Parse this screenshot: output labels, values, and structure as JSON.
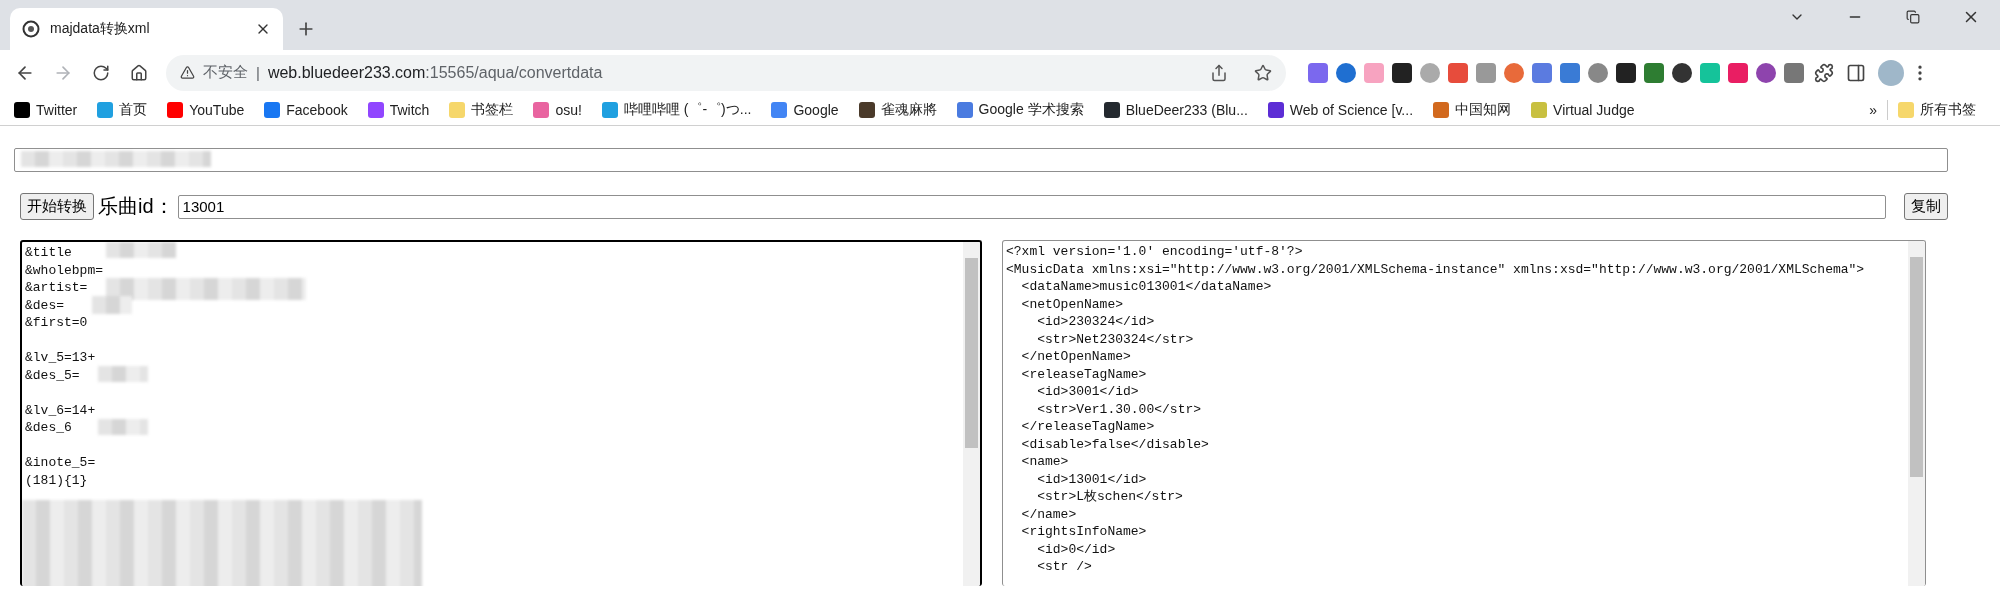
{
  "browser": {
    "tab": {
      "title": "majdata转换xml",
      "selected": true
    },
    "address": {
      "security": "不安全",
      "separator": "|",
      "host": "web.bluedeer233.com",
      "path": ":15565/aqua/convertdata"
    },
    "forward_disabled": true,
    "bookmarks": [
      {
        "label": "Twitter",
        "color": "#000000"
      },
      {
        "label": "首页",
        "color": "#20a0e0"
      },
      {
        "label": "YouTube",
        "color": "#ff0000"
      },
      {
        "label": "Facebook",
        "color": "#1877f2"
      },
      {
        "label": "Twitch",
        "color": "#9146ff"
      },
      {
        "label": "书签栏",
        "color": "#f6d76b"
      },
      {
        "label": "osu!",
        "color": "#e964a0"
      },
      {
        "label": "哔哩哔哩 (゜-゜)つ...",
        "color": "#20a0e0"
      },
      {
        "label": "Google",
        "color": "#4285f4"
      },
      {
        "label": "雀魂麻將",
        "color": "#4a3a2a"
      },
      {
        "label": "Google 学术搜索",
        "color": "#4a7be0"
      },
      {
        "label": "BlueDeer233 (Blu...",
        "color": "#24292f"
      },
      {
        "label": "Web of Science [v...",
        "color": "#5c2dd5"
      },
      {
        "label": "中国知网",
        "color": "#d2691e"
      },
      {
        "label": "Virtual Judge",
        "color": "#c8c040"
      }
    ],
    "overflow": "»",
    "all_bookmarks": {
      "label": "所有书签",
      "color": "#f6d76b"
    }
  },
  "page": {
    "start_button": "开始转换",
    "id_label": "乐曲id：",
    "id_value": "13001",
    "copy_button": "复制",
    "source": {
      "focused": true,
      "blocks": [
        [
          "&title",
          "&wholebpm=",
          "&artist=",
          "&des=",
          "&first=0"
        ],
        [
          "&lv_5=13+",
          "&des_5="
        ],
        [
          "&lv_6=14+",
          "&des_6"
        ],
        [
          "&inote_5=",
          "(181){1}"
        ]
      ]
    },
    "output": {
      "focused": false,
      "blocks": [
        [
          "<?xml version='1.0' encoding='utf-8'?>",
          "<MusicData xmlns:xsi=\"http://www.w3.org/2001/XMLSchema-instance\" xmlns:xsd=\"http://www.w3.org/2001/XMLSchema\">",
          "  <dataName>music013001</dataName>",
          "  <netOpenName>",
          "    <id>230324</id>",
          "    <str>Net230324</str>",
          "  </netOpenName>",
          "  <releaseTagName>",
          "    <id>3001</id>",
          "    <str>Ver1.30.00</str>",
          "  </releaseTagName>",
          "  <disable>false</disable>",
          "  <name>",
          "    <id>13001</id>",
          "    <str>L枚schen</str>",
          "  </name>",
          "  <rightsInfoName>",
          "    <id>0</id>",
          "    <str />"
        ]
      ]
    }
  }
}
